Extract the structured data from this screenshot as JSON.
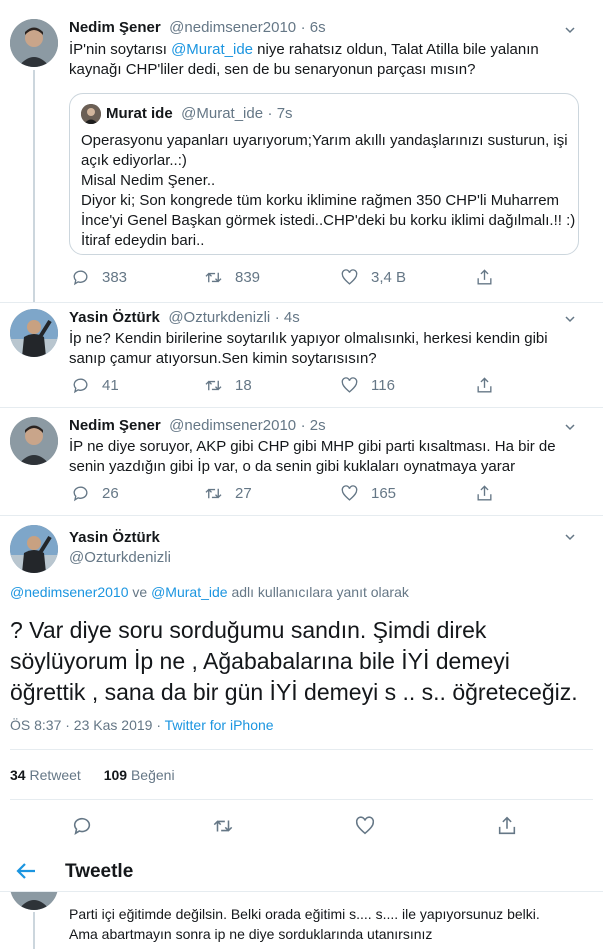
{
  "tweet1": {
    "name": "Nedim Şener",
    "handle": "@nedimsener2010",
    "time": "· 6s",
    "text_a": "İP'nin soytarısı ",
    "mention": "@Murat_ide",
    "text_b": " niye rahatsız oldun, Talat Atilla bile yalanın",
    "text_c": "kaynağı CHP'liler dedi, sen de bu senaryonun parçası mısın?",
    "quote": {
      "name": "Murat ide",
      "handle": "@Murat_ide",
      "time": "· 7s",
      "lines": [
        "Operasyonu yapanları uyarıyorum;Yarım akıllı yandaşlarınızı susturun, işi",
        "açık ediyorlar..:)",
        "Misal Nedim Şener..",
        "Diyor ki; Son kongrede tüm korku iklimine rağmen 350 CHP'li Muharrem",
        "İnce'yi Genel Başkan görmek istedi..CHP'deki bu korku iklimi dağılmalı.!! :)",
        "İtiraf edeydin bari.."
      ]
    },
    "replies": "383",
    "retweets": "839",
    "likes": "3,4 B"
  },
  "tweet2": {
    "name": "Yasin Öztürk",
    "handle": "@Ozturkdenizli",
    "time": "· 4s",
    "line1": "İp ne? Kendin birilerine soytarılık yapıyor olmalısınki, herkesi kendin gibi",
    "line2": "sanıp çamur atıyorsun.Sen kimin soytarısısın?",
    "replies": "41",
    "retweets": "18",
    "likes": "116"
  },
  "tweet3": {
    "name": "Nedim Şener",
    "handle": "@nedimsener2010",
    "time": "· 2s",
    "line1": "İP ne diye soruyor, AKP gibi CHP gibi MHP gibi parti kısaltması. Ha bir de",
    "line2": "senin yazdığın gibi İp var, o da senin gibi kuklaları oynatmaya yarar",
    "replies": "26",
    "retweets": "27",
    "likes": "165"
  },
  "main": {
    "name": "Yasin Öztürk",
    "handle": "@Ozturkdenizli",
    "reply_mention1": "@nedimsener2010",
    "reply_ve": " ve ",
    "reply_mention2": "@Murat_ide",
    "reply_suffix": " adlı kullanıcılara yanıt olarak",
    "line1": "? Var diye soru sorduğumu sandın. Şimdi direk",
    "line2": "söylüyorum İp ne , Ağababalarına bile İYİ demeyi",
    "line3": "öğrettik , sana da bir gün İYİ demeyi s .. s.. öğreteceğiz.",
    "time": "ÖS 8:37 · 23 Kas 2019 · ",
    "source": "Twitter for iPhone",
    "retweet_count": "34",
    "retweet_label": " Retweet",
    "like_count": "109",
    "like_label": " Beğeni"
  },
  "header": {
    "title": "Tweetle"
  },
  "bottom_reply": {
    "line1": "Parti içi eğitimde değilsin. Belki orada eğitimi s.... s.... ile yapıyorsunuz belki.",
    "line2": "Ama abartmayın sonra ip ne diye sorduklarında utanırsınız"
  },
  "colors": {
    "accent": "#1b95e0",
    "muted": "#657786",
    "text": "#14171a",
    "border": "#e6ecf0"
  }
}
